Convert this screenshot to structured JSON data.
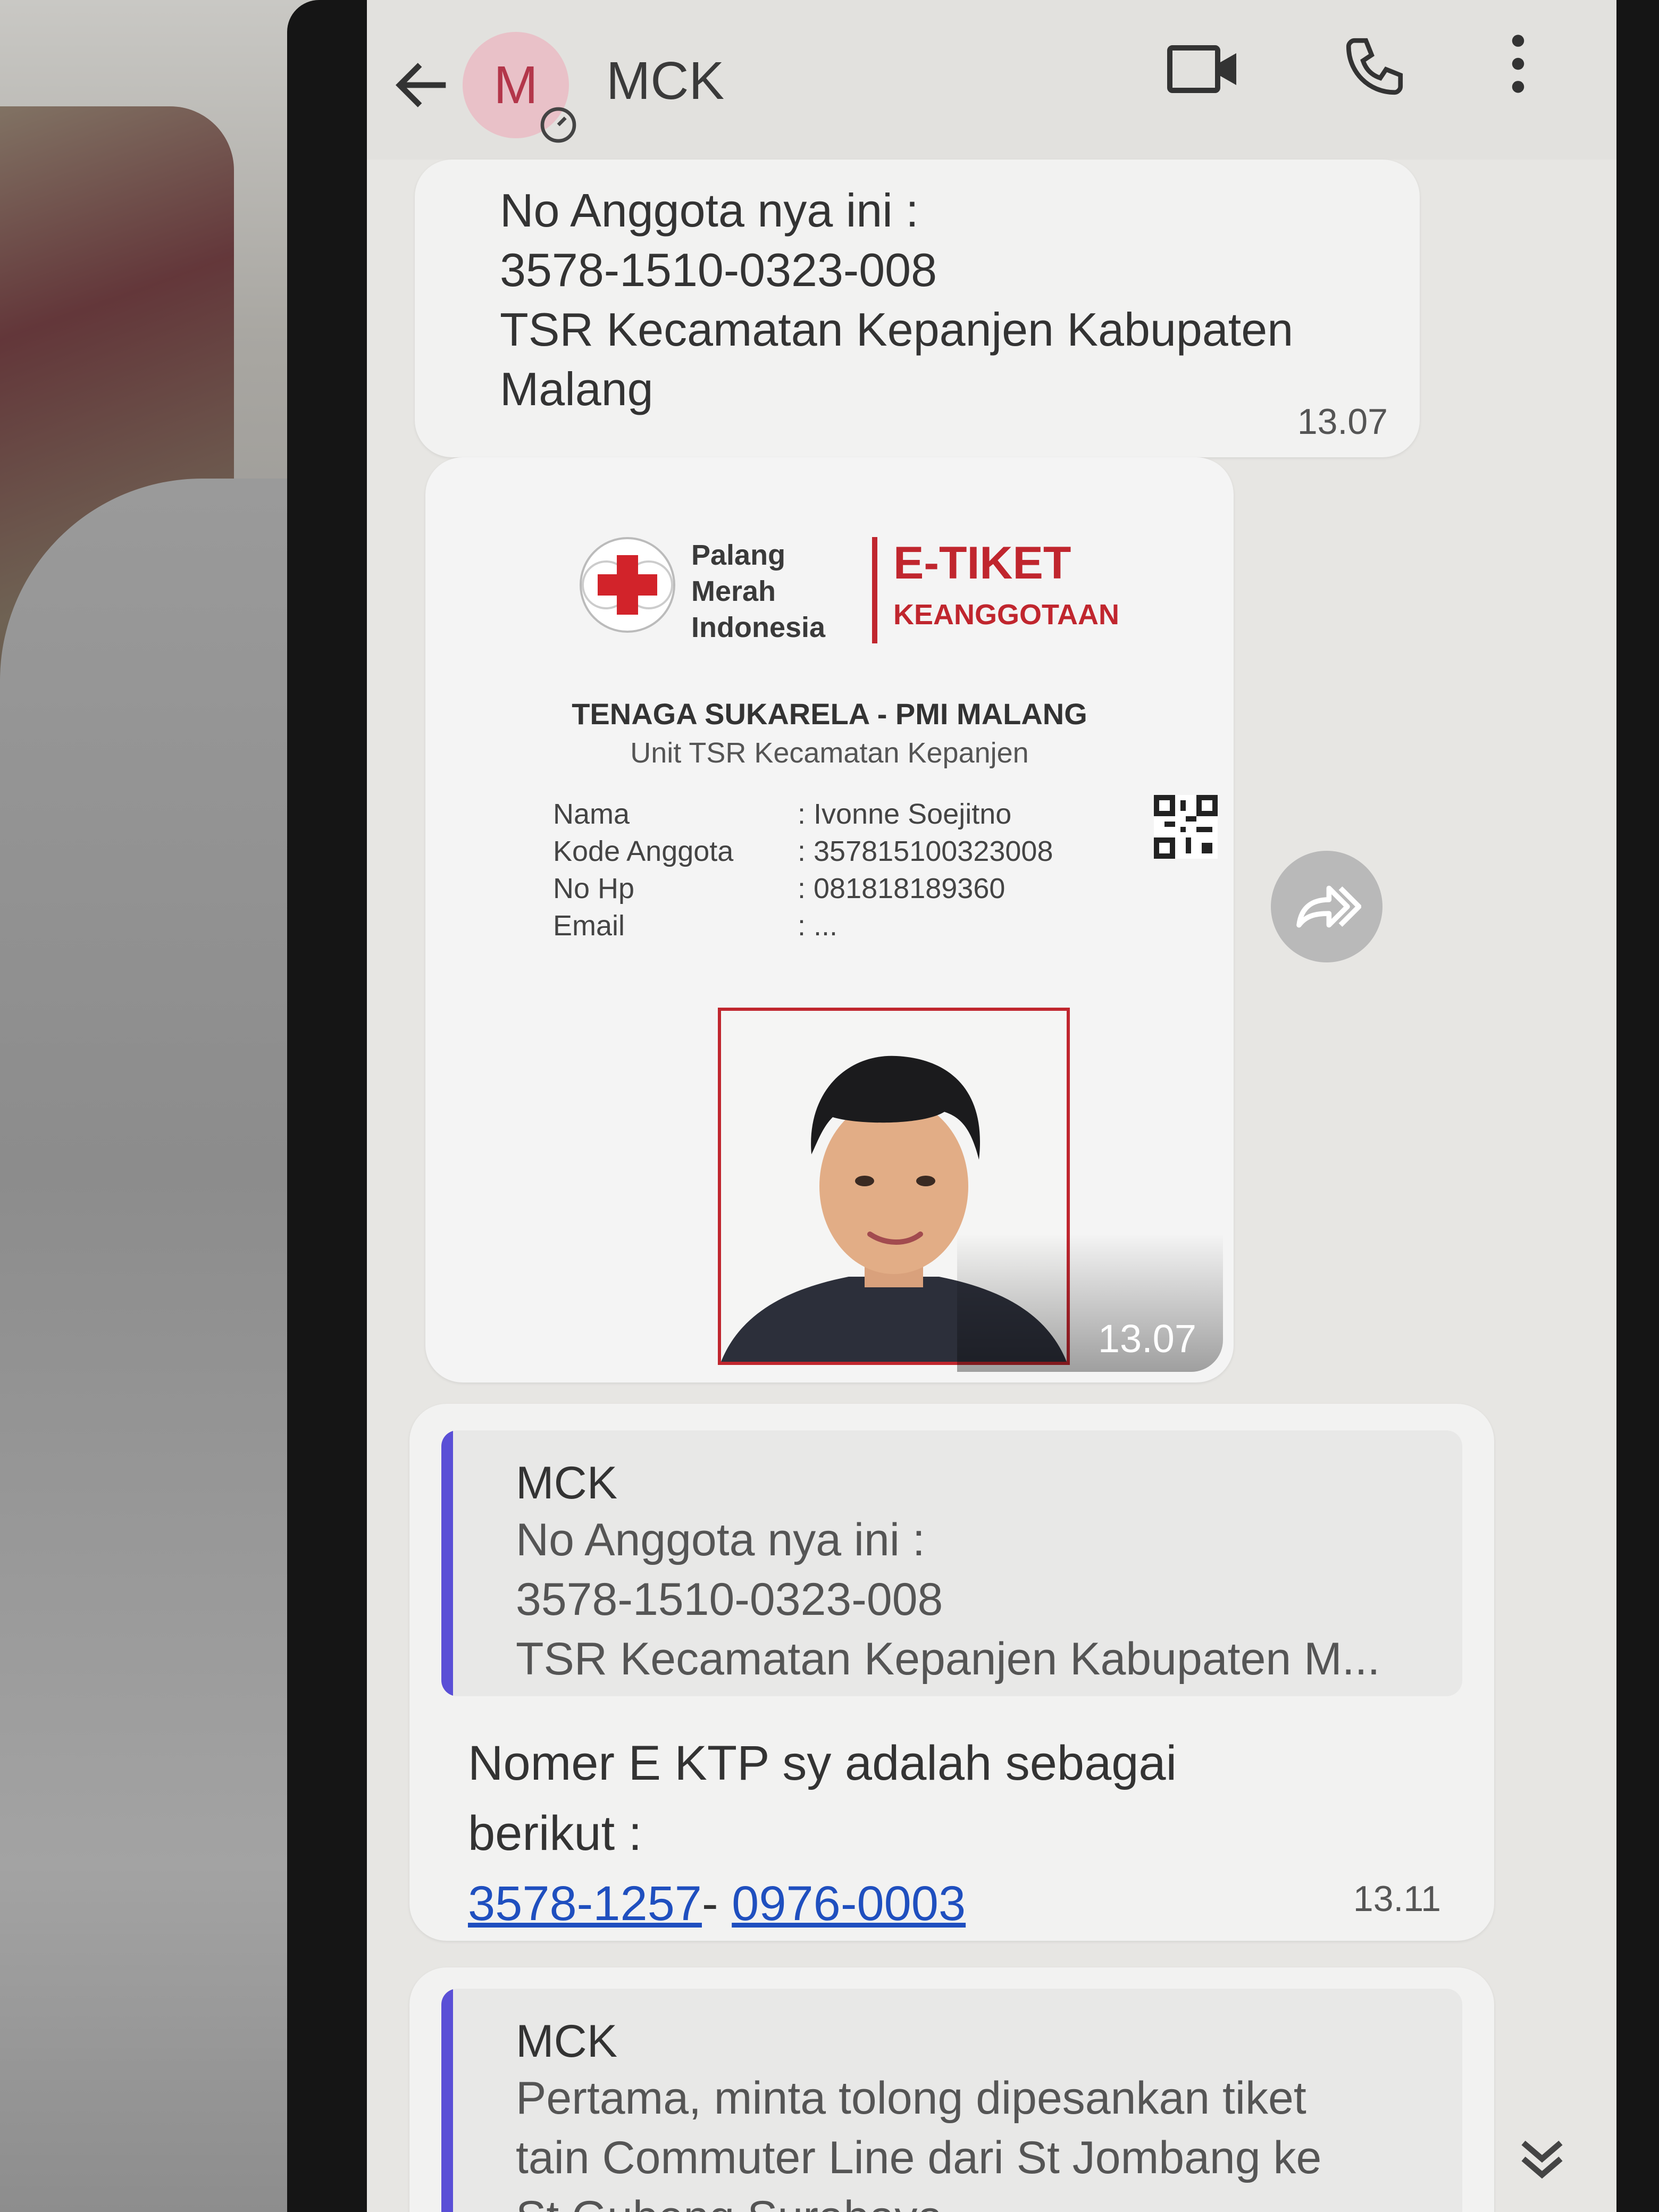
{
  "header": {
    "avatar_letter": "M",
    "title": "MCK"
  },
  "message1": {
    "lines": [
      "No Anggota nya ini :",
      "3578-1510-0323-008",
      "TSR Kecamatan Kepanjen Kabupaten",
      "Malang"
    ],
    "time": "13.07"
  },
  "image_message": {
    "time": "13.07",
    "ticket": {
      "org_name": [
        "Palang",
        "Merah",
        "Indonesia"
      ],
      "title": "E-TIKET",
      "subtitle": "KEANGGOTAAN",
      "heading": "TENAGA SUKARELA - PMI MALANG",
      "unit": "Unit TSR Kecamatan Kepanjen",
      "fields": [
        {
          "label": "Nama",
          "value": ": Ivonne Soejitno"
        },
        {
          "label": "Kode Anggota",
          "value": ": 357815100323008"
        },
        {
          "label": "No Hp",
          "value": ": 081818189360"
        },
        {
          "label": "Email",
          "value": ": ..."
        }
      ]
    }
  },
  "message2": {
    "reply": {
      "sender": "MCK",
      "text": "No Anggota nya ini :\n3578-1510-0323-008\nTSR Kecamatan Kepanjen Kabupaten M..."
    },
    "body_line1": "Nomer E KTP sy adalah sebagai",
    "body_line2": "berikut :",
    "link1": "3578-1257",
    "separator": "- ",
    "link2": "0976-0003",
    "time": "13.11"
  },
  "message3": {
    "reply": {
      "sender": "MCK",
      "text": "Pertama, minta tolong dipesankan tiket\ntain Commuter Line dari St Jombang ke\nSt Gubeng Surabaya"
    }
  },
  "colors": {
    "accent_red": "#c0262e",
    "reply_bar": "#5a4fd6",
    "link": "#1f4fbf"
  },
  "icons": [
    "back-arrow-icon",
    "video-call-icon",
    "phone-icon",
    "more-vertical-icon",
    "forward-icon",
    "chevron-double-down-icon",
    "red-cross-icon",
    "qr-code-icon"
  ]
}
